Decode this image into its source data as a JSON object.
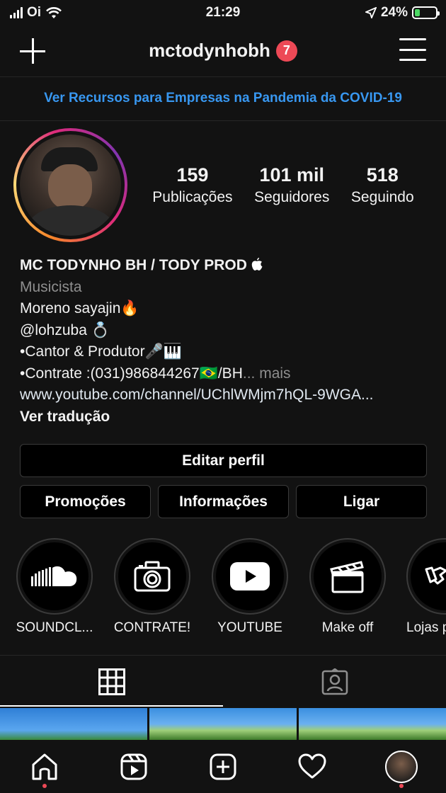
{
  "status_bar": {
    "carrier": "Oi",
    "time": "21:29",
    "battery": "24%",
    "battery_level": 0.24,
    "colors": {
      "battery_fill": "#4cd964"
    }
  },
  "header": {
    "username": "mctodynhobh",
    "notification_count": "7",
    "icons": [
      "plus-icon",
      "hamburger-menu-icon"
    ]
  },
  "banner": {
    "text": "Ver Recursos para Empresas na Pandemia da COVID-19",
    "color": "#3897f0"
  },
  "profile": {
    "stats": [
      {
        "value": "159",
        "label": "Publicações"
      },
      {
        "value": "101 mil",
        "label": "Seguidores"
      },
      {
        "value": "518",
        "label": "Seguindo"
      }
    ]
  },
  "bio": {
    "name": "MC TODYNHO BH / TODY PROD ",
    "category": "Musicista",
    "lines": [
      "Moreno sayajin🔥",
      "@lohzuba 💍",
      "•Cantor & Produtor🎤🎹",
      "•Contrate :(031)986844267🇧🇷/BH"
    ],
    "more": "... mais",
    "link": "www.youtube.com/channel/UChlWMjm7hQL-9WGA...",
    "translate": "Ver tradução"
  },
  "buttons": {
    "edit_profile": "Editar perfil",
    "promotions": "Promoções",
    "info": "Informações",
    "call": "Ligar"
  },
  "highlights": [
    {
      "label": "SOUNDCL...",
      "icon": "soundcloud-icon"
    },
    {
      "label": "CONTRATE!",
      "icon": "camera-icon"
    },
    {
      "label": "YOUTUBE",
      "icon": "youtube-icon"
    },
    {
      "label": "Make off",
      "icon": "clapperboard-icon"
    },
    {
      "label": "Lojas p",
      "icon": "handshake-icon"
    }
  ],
  "tabs": [
    {
      "name": "grid",
      "icon": "grid-icon",
      "active": true
    },
    {
      "name": "tagged",
      "icon": "tagged-person-icon",
      "active": false
    }
  ],
  "bottom_nav": [
    {
      "icon": "home-icon",
      "dot": true
    },
    {
      "icon": "reels-icon",
      "dot": false
    },
    {
      "icon": "add-post-icon",
      "dot": false
    },
    {
      "icon": "heart-icon",
      "dot": false
    },
    {
      "icon": "profile-avatar-icon",
      "dot": true
    }
  ],
  "colors": {
    "background": "#121212",
    "notification": "#ed4956",
    "link_blue": "#3897f0"
  }
}
